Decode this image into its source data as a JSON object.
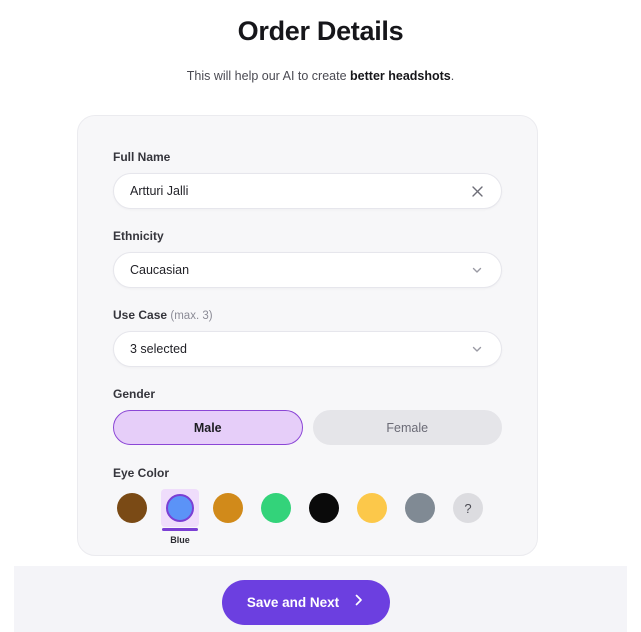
{
  "header": {
    "title": "Order Details",
    "subtitle_prefix": "This will help our AI to create ",
    "subtitle_bold": "better headshots",
    "subtitle_suffix": "."
  },
  "form": {
    "full_name": {
      "label": "Full Name",
      "value": "Artturi Jalli",
      "placeholder": "Full Name",
      "clear_icon": "close-icon"
    },
    "ethnicity": {
      "label": "Ethnicity",
      "value": "Caucasian",
      "chevron_icon": "chevron-down-icon"
    },
    "use_case": {
      "label": "Use Case",
      "hint": "(max. 3)",
      "value": "3 selected",
      "chevron_icon": "chevron-down-icon"
    },
    "gender": {
      "label": "Gender",
      "options": [
        {
          "label": "Male",
          "selected": true
        },
        {
          "label": "Female",
          "selected": false
        }
      ]
    },
    "eye_color": {
      "label": "Eye Color",
      "selected_caption": "Blue",
      "options": [
        {
          "name": "brown",
          "color": "#7a4a15",
          "selected": false
        },
        {
          "name": "blue",
          "color": "#5b93f7",
          "selected": true
        },
        {
          "name": "amber",
          "color": "#d18a1a",
          "selected": false
        },
        {
          "name": "green",
          "color": "#33d37a",
          "selected": false
        },
        {
          "name": "black",
          "color": "#0a0a0a",
          "selected": false
        },
        {
          "name": "yellow",
          "color": "#fcc84a",
          "selected": false
        },
        {
          "name": "gray",
          "color": "#808a94",
          "selected": false
        },
        {
          "name": "unknown",
          "color": "#dcdce0",
          "selected": false,
          "glyph": "?"
        }
      ]
    }
  },
  "footer": {
    "primary_button": {
      "label": "Save and Next",
      "icon": "chevron-right-icon"
    }
  },
  "colors": {
    "accent": "#6c3fe0",
    "selected_border": "#8b46d6",
    "selected_fill": "#e6cef9",
    "card_bg": "#f7f7f9",
    "footer_bg": "#f4f4f8"
  }
}
